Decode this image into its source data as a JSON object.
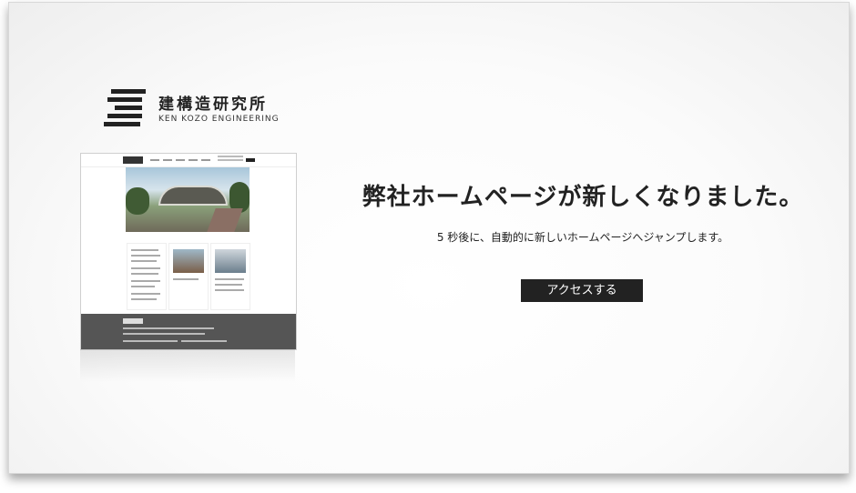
{
  "logo": {
    "name_jp": "建構造研究所",
    "name_en": "KEN KOZO ENGINEERING",
    "mark_icon": "striped-logo-mark"
  },
  "main": {
    "headline": "弊社ホームページが新しくなりました。",
    "subline": "5 秒後に、自動的に新しいホームページへジャンプします。",
    "access_button_label": "アクセスする"
  },
  "colors": {
    "text": "#222222",
    "button_bg": "#222222",
    "button_text": "#ffffff",
    "footer_bg": "#555555"
  }
}
